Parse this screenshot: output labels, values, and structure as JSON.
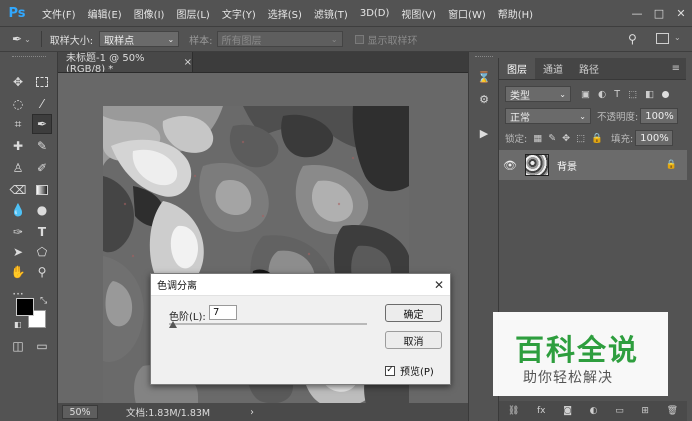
{
  "app": {
    "logo": "Ps",
    "menu": [
      "文件(F)",
      "编辑(E)",
      "图像(I)",
      "图层(L)",
      "文字(Y)",
      "选择(S)",
      "滤镜(T)",
      "3D(D)",
      "视图(V)",
      "窗口(W)",
      "帮助(H)"
    ],
    "window_controls": [
      "—",
      "□",
      "✕"
    ]
  },
  "options_bar": {
    "sample_size_label": "取样大小:",
    "sample_size_value": "取样点",
    "sample_label": "样本:",
    "sample_value": "所有图层",
    "show_ring_label": "显示取样环"
  },
  "document": {
    "tab_title": "未标题-1 @ 50%(RGB/8) *",
    "tab_close": "×",
    "zoom": "50%",
    "doc_info": "文档:1.83M/1.83M",
    "status_arrow": "›"
  },
  "layers_panel": {
    "tabs": [
      "图层",
      "通道",
      "路径"
    ],
    "filter_kind": "类型",
    "blend_mode": "正常",
    "opacity_label": "不透明度:",
    "opacity_value": "100%",
    "lock_label": "锁定:",
    "fill_label": "填充:",
    "fill_value": "100%",
    "layer_name": "背景"
  },
  "posterize_dialog": {
    "title": "色调分离",
    "close": "✕",
    "levels_label": "色阶(L):",
    "levels_value": "7",
    "levels_fraction": 0.02,
    "ok_label": "确定",
    "cancel_label": "取消",
    "preview_label": "预览(P)",
    "preview_checked": true
  },
  "watermark": {
    "title": "百科全说",
    "subtitle": "助你轻松解决"
  },
  "colors": {
    "foreground": "#000000",
    "background": "#ffffff",
    "accent": "#31a8ff",
    "watermark_green": "#2e9e3e"
  }
}
